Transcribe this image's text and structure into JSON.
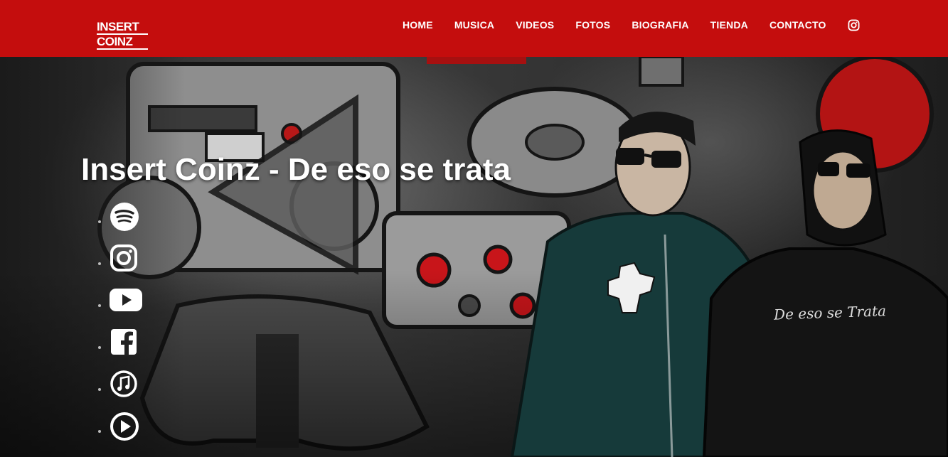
{
  "brand": {
    "logo_line1": "INSERT",
    "logo_line2": "COINZ"
  },
  "nav": {
    "items": [
      "HOME",
      "MUSICA",
      "VIDEOS",
      "FOTOS",
      "BIOGRAFIA",
      "TIENDA",
      "CONTACTO"
    ],
    "instagram_icon": "instagram-icon"
  },
  "hero": {
    "title": "Insert Coinz - De eso se trata",
    "social_icons": [
      "spotify-icon",
      "instagram-icon",
      "youtube-icon",
      "facebook-icon",
      "itunes-icon",
      "play-icon"
    ],
    "shirt_text": "De eso se Trata",
    "watermark": "De eso se trata"
  },
  "colors": {
    "nav_bg": "#c40d0d",
    "accent_red": "#c8151a",
    "text": "#ffffff"
  }
}
